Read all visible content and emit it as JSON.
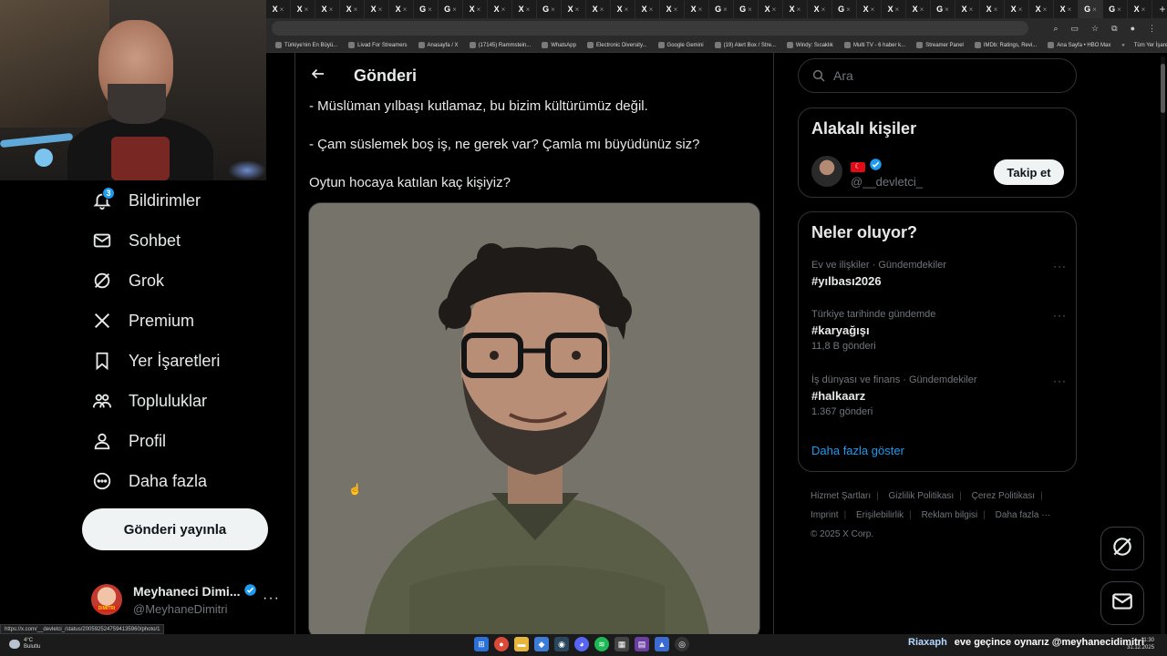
{
  "browser": {
    "tab_favicons": [
      "X",
      "X",
      "X",
      "X",
      "X",
      "X",
      "G",
      "G",
      "X",
      "X",
      "X",
      "G",
      "X",
      "X",
      "X",
      "X",
      "X",
      "X",
      "G",
      "G",
      "X",
      "X",
      "X",
      "G",
      "X",
      "X",
      "X",
      "G",
      "X",
      "X",
      "X",
      "X",
      "X",
      "G",
      "G",
      "X"
    ],
    "new_tab": "+",
    "bookmarks": [
      "Türkiye'nin En Büyü...",
      "Livad For Streamers",
      "Anasayfa / X",
      "(17145) Rammstein...",
      "WhatsApp",
      "Electronic Diversity...",
      "Google Gemini",
      "(19) Alert Box / Stre...",
      "Windy: Sıcaklık",
      "Multi TV - 6 haber k...",
      "Streamer Panel",
      "IMDb: Ratings, Revi...",
      "Ana Sayfa • HBO Max"
    ],
    "bookmarks_overflow": "»",
    "all_bookmarks": "Tüm Yer İşaretleri",
    "status_url": "https://x.com/__devletci_/status/2005925247594135960/photo/1"
  },
  "nav": {
    "notifications_label": "Bildirimler",
    "notifications_badge": "3",
    "chat_label": "Sohbet",
    "grok_label": "Grok",
    "premium_label": "Premium",
    "bookmarks_label": "Yer İşaretleri",
    "communities_label": "Topluluklar",
    "profile_label": "Profil",
    "more_label": "Daha fazla",
    "post_button": "Gönderi yayınla"
  },
  "account": {
    "name": "Meyhaneci Dimi...",
    "handle": "@MeyhaneDimitri",
    "avatar_tag": "DIMITRI",
    "more": "···"
  },
  "post": {
    "header_title": "Gönderi",
    "lines": [
      "- Müslüman yılbaşı kutlamaz, bu bizim kültürümüz değil.",
      "- Çam süslemek boş iş, ne gerek var? Çamla mı büyüdünüz siz?",
      "Oytun hocaya katılan kaç kişiyiz?"
    ]
  },
  "search": {
    "placeholder": "Ara"
  },
  "related": {
    "title": "Alakalı kişiler",
    "handle": "@__devletci_",
    "follow_button": "Takip et"
  },
  "trends": {
    "title": "Neler oluyor?",
    "items": [
      {
        "context": "Ev ve ilişkiler · Gündemdekiler",
        "name": "#yılbası2026",
        "count": ""
      },
      {
        "context": "Türkiye tarihinde gündemde",
        "name": "#karyağışı",
        "count": "11,8 B gönderi"
      },
      {
        "context": "İş dünyası ve finans · Gündemdekiler",
        "name": "#halkaarz",
        "count": "1.367 gönderi"
      }
    ],
    "show_more": "Daha fazla göster"
  },
  "footer": {
    "links_row1": [
      "Hizmet Şartları",
      "Gizlilik Politikası",
      "Çerez Politikası"
    ],
    "links_row2": [
      "Imprint",
      "Erişilebilirlik",
      "Reklam bilgisi",
      "Daha fazla ···"
    ],
    "copyright": "© 2025 X Corp."
  },
  "taskbar": {
    "weather_temp": "4°C",
    "weather_desc": "Bulutlu",
    "ticker_name": "Riaxaph",
    "ticker_text": "eve geçince oynarız @meyhanecidimitri",
    "time": "11:30",
    "date": "31.12.2025"
  },
  "colors": {
    "accent": "#1d9bf0",
    "background": "#000000",
    "border": "#2f3336",
    "muted_text": "#71767b",
    "flag_red": "#e30a17"
  }
}
